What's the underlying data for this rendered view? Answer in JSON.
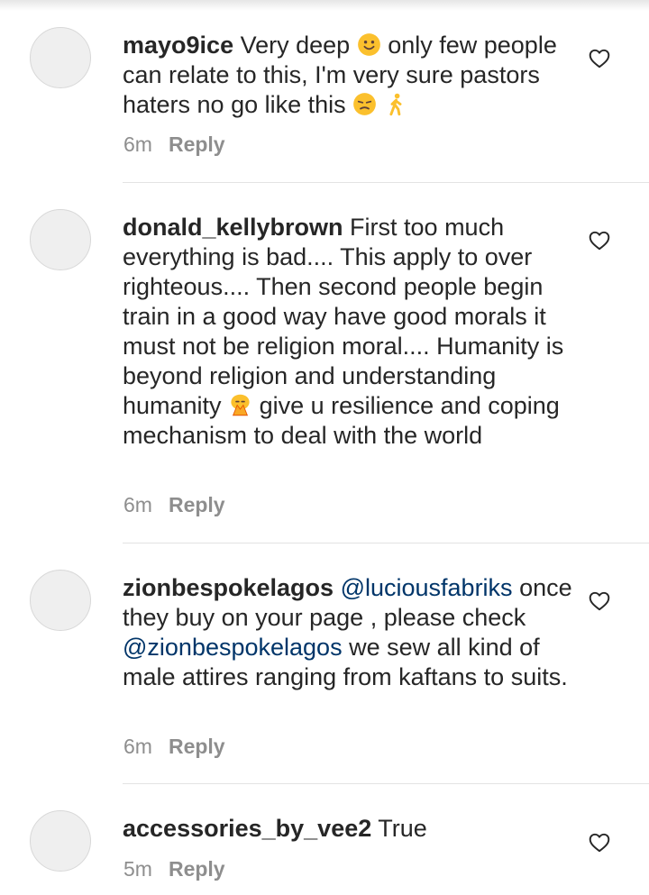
{
  "comments": [
    {
      "username": "mayo9ice",
      "text_1": " Very deep ",
      "emoji_1": "slightly-smiling-face",
      "text_2": " only few people can relate to this, I'm very sure pastors haters no go like this ",
      "emoji_2": "unamused-face",
      "emoji_3": "walking-person",
      "time": "6m",
      "reply": "Reply"
    },
    {
      "username": "donald_kellybrown",
      "text_1": " First too much everything is bad.... This apply to over righteous.... Then second people begin train in a good way have good morals it must not be religion moral.... Humanity is beyond religion and understanding humanity ",
      "emoji_1": "folded-hands-bowing",
      "text_2": " give u resilience and coping mechanism to deal with the world",
      "time": "6m",
      "reply": "Reply"
    },
    {
      "username": "zionbespokelagos",
      "mention_1": "@luciousfabriks",
      "text_1": " once they buy on your page , please check ",
      "mention_2": "@zionbespokelagos",
      "text_2": " we sew all kind of male attires ranging from kaftans to suits.",
      "time": "6m",
      "reply": "Reply"
    },
    {
      "username": "accessories_by_vee2",
      "text_1": " True",
      "time": "5m",
      "reply": "Reply"
    }
  ],
  "colors": {
    "text": "#262626",
    "meta": "#8e8e8e",
    "mention": "#003569",
    "emoji": "#fbc02d"
  },
  "icons": {
    "like": "heart-outline-icon"
  }
}
